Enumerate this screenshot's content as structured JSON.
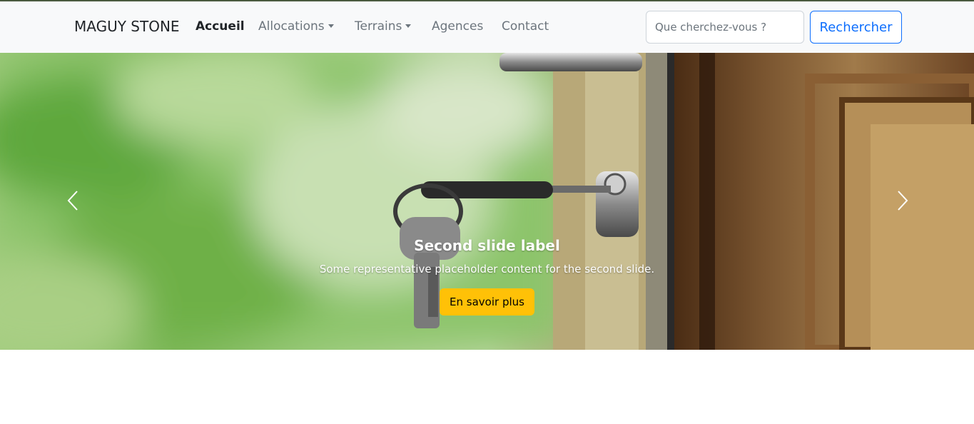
{
  "navbar": {
    "brand": "MAGUY STONE",
    "links": [
      {
        "label": "Accueil"
      },
      {
        "label": "Allocations"
      },
      {
        "label": "Terrains"
      },
      {
        "label": "Agences"
      },
      {
        "label": "Contact"
      }
    ],
    "search": {
      "placeholder": "Que cherchez-vous ?",
      "value": "",
      "button_label": "Rechercher"
    }
  },
  "carousel": {
    "slide": {
      "title": "Second slide label",
      "text": "Some representative placeholder content for the second slide.",
      "button_label": "En savoir plus"
    },
    "controls": {
      "prev_icon": "chevron-left-icon",
      "next_icon": "chevron-right-icon"
    }
  },
  "colors": {
    "navbar_bg": "#f8f9fa",
    "primary": "#0d6efd",
    "warning": "#ffc107",
    "muted": "#6c757d"
  }
}
